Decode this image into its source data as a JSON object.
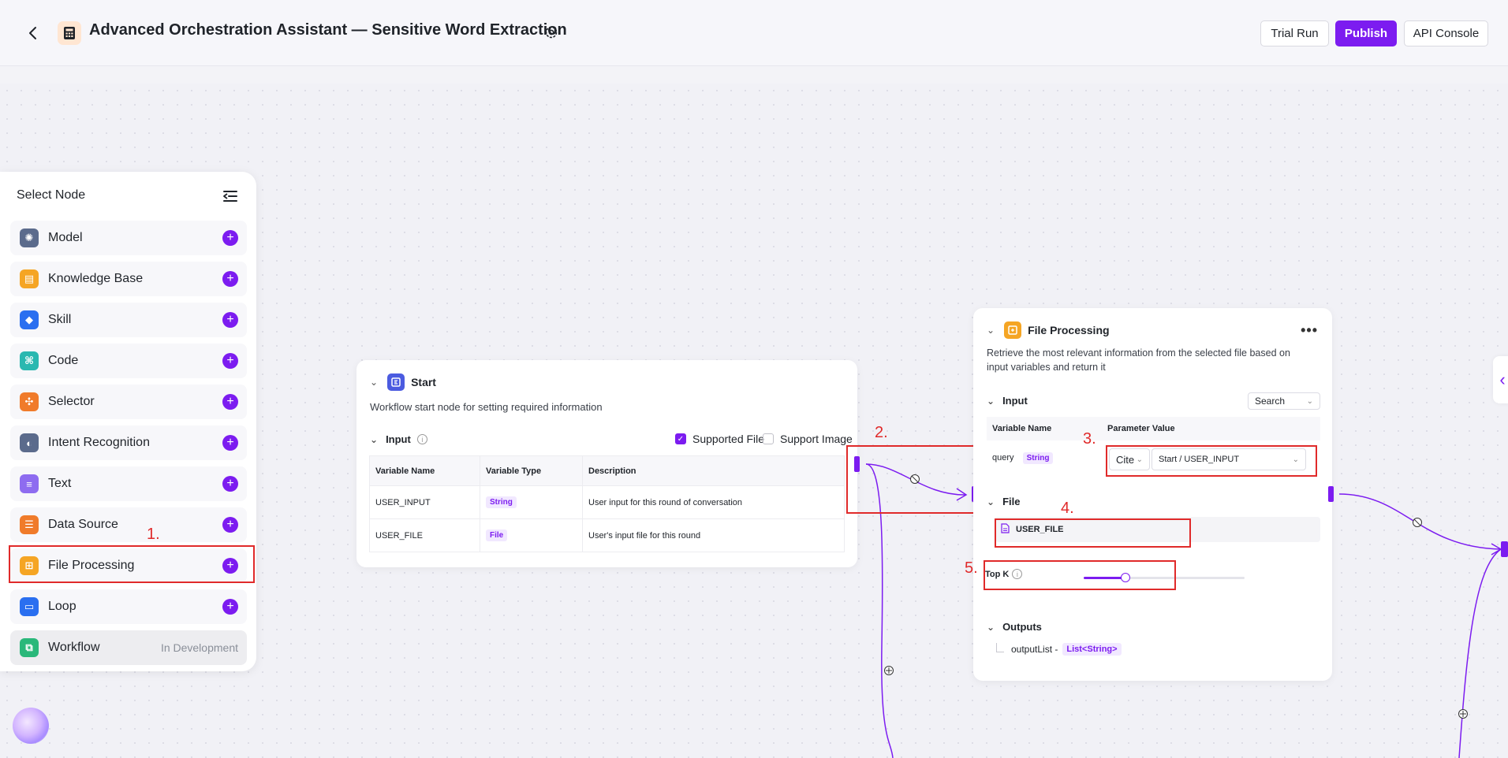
{
  "header": {
    "title": "Advanced Orchestration Assistant — Sensitive Word Extraction",
    "trial_run": "Trial Run",
    "publish": "Publish",
    "api_console": "API Console"
  },
  "node_panel": {
    "title": "Select Node",
    "items": [
      {
        "label": "Model",
        "icon": "model-icon",
        "color": "#5b6b8c"
      },
      {
        "label": "Knowledge Base",
        "icon": "knowledge-base-icon",
        "color": "#f5a524"
      },
      {
        "label": "Skill",
        "icon": "skill-icon",
        "color": "#2a6ff0"
      },
      {
        "label": "Code",
        "icon": "code-icon",
        "color": "#2ab8b0"
      },
      {
        "label": "Selector",
        "icon": "selector-icon",
        "color": "#f07b2a"
      },
      {
        "label": "Intent Recognition",
        "icon": "intent-icon",
        "color": "#5b6b8c"
      },
      {
        "label": "Text",
        "icon": "text-icon",
        "color": "#8e6cf0"
      },
      {
        "label": "Data Source",
        "icon": "data-source-icon",
        "color": "#f07b2a"
      },
      {
        "label": "File Processing",
        "icon": "file-processing-icon",
        "color": "#f5a524"
      },
      {
        "label": "Loop",
        "icon": "loop-icon",
        "color": "#2a6ff0"
      },
      {
        "label": "Workflow",
        "icon": "workflow-icon",
        "color": "#2ab87a"
      }
    ],
    "workflow_status": "In Development"
  },
  "annotations": [
    "1.",
    "2.",
    "3.",
    "4.",
    "5."
  ],
  "start_node": {
    "name": "Start",
    "description": "Workflow start node for setting required information",
    "input_label": "Input",
    "supported_file": "Supported File",
    "support_image": "Support Image",
    "supported_file_checked": true,
    "support_image_checked": false,
    "columns": [
      "Variable Name",
      "Variable Type",
      "Description"
    ],
    "rows": [
      {
        "name": "USER_INPUT",
        "type": "String",
        "description": "User input for this round of conversation"
      },
      {
        "name": "USER_FILE",
        "type": "File",
        "description": "User's input file for this round"
      }
    ]
  },
  "fp_node": {
    "name": "File Processing",
    "description_line1": "Retrieve the most relevant information from the selected file based on",
    "description_line2": "input variables and return it",
    "input_label": "Input",
    "search_select": "Search",
    "columns": [
      "Variable Name",
      "Parameter Value"
    ],
    "param_name": "query",
    "param_type": "String",
    "cite_select": "Cite",
    "source_select": "Start / USER_INPUT",
    "file_label": "File",
    "file_value": "USER_FILE",
    "top_k_label": "Top K",
    "top_k_fraction": 0.26,
    "outputs_label": "Outputs",
    "output_name": "outputList -",
    "output_type": "List<String>"
  }
}
